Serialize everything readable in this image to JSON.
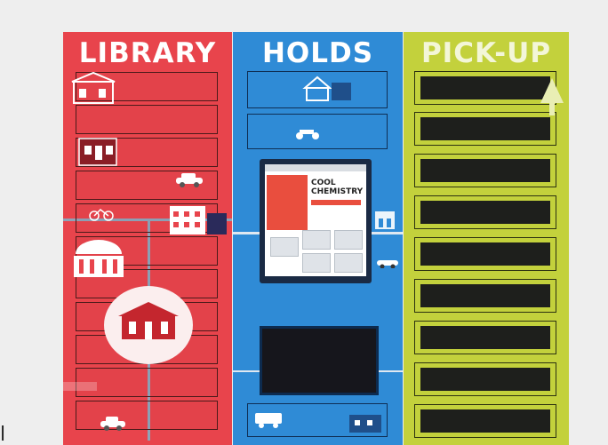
{
  "panels": {
    "library": {
      "title": "LIBRARY",
      "color": "#e8444c"
    },
    "holds": {
      "title": "HOLDS",
      "color": "#2f8bd6"
    },
    "pickup": {
      "title": "PICK-UP",
      "color": "#c3d13c"
    }
  },
  "screen": {
    "book_title_line1": "COOL",
    "book_title_line2": "CHEMISTRY"
  },
  "icons": [
    "fire-station-icon",
    "restaurant-icon",
    "house-icon",
    "car-icon",
    "bicycle-icon",
    "library-building-icon",
    "museum-icon",
    "airport-icon",
    "scooter-icon",
    "bus-icon",
    "ymca-icon",
    "tree-icon"
  ]
}
